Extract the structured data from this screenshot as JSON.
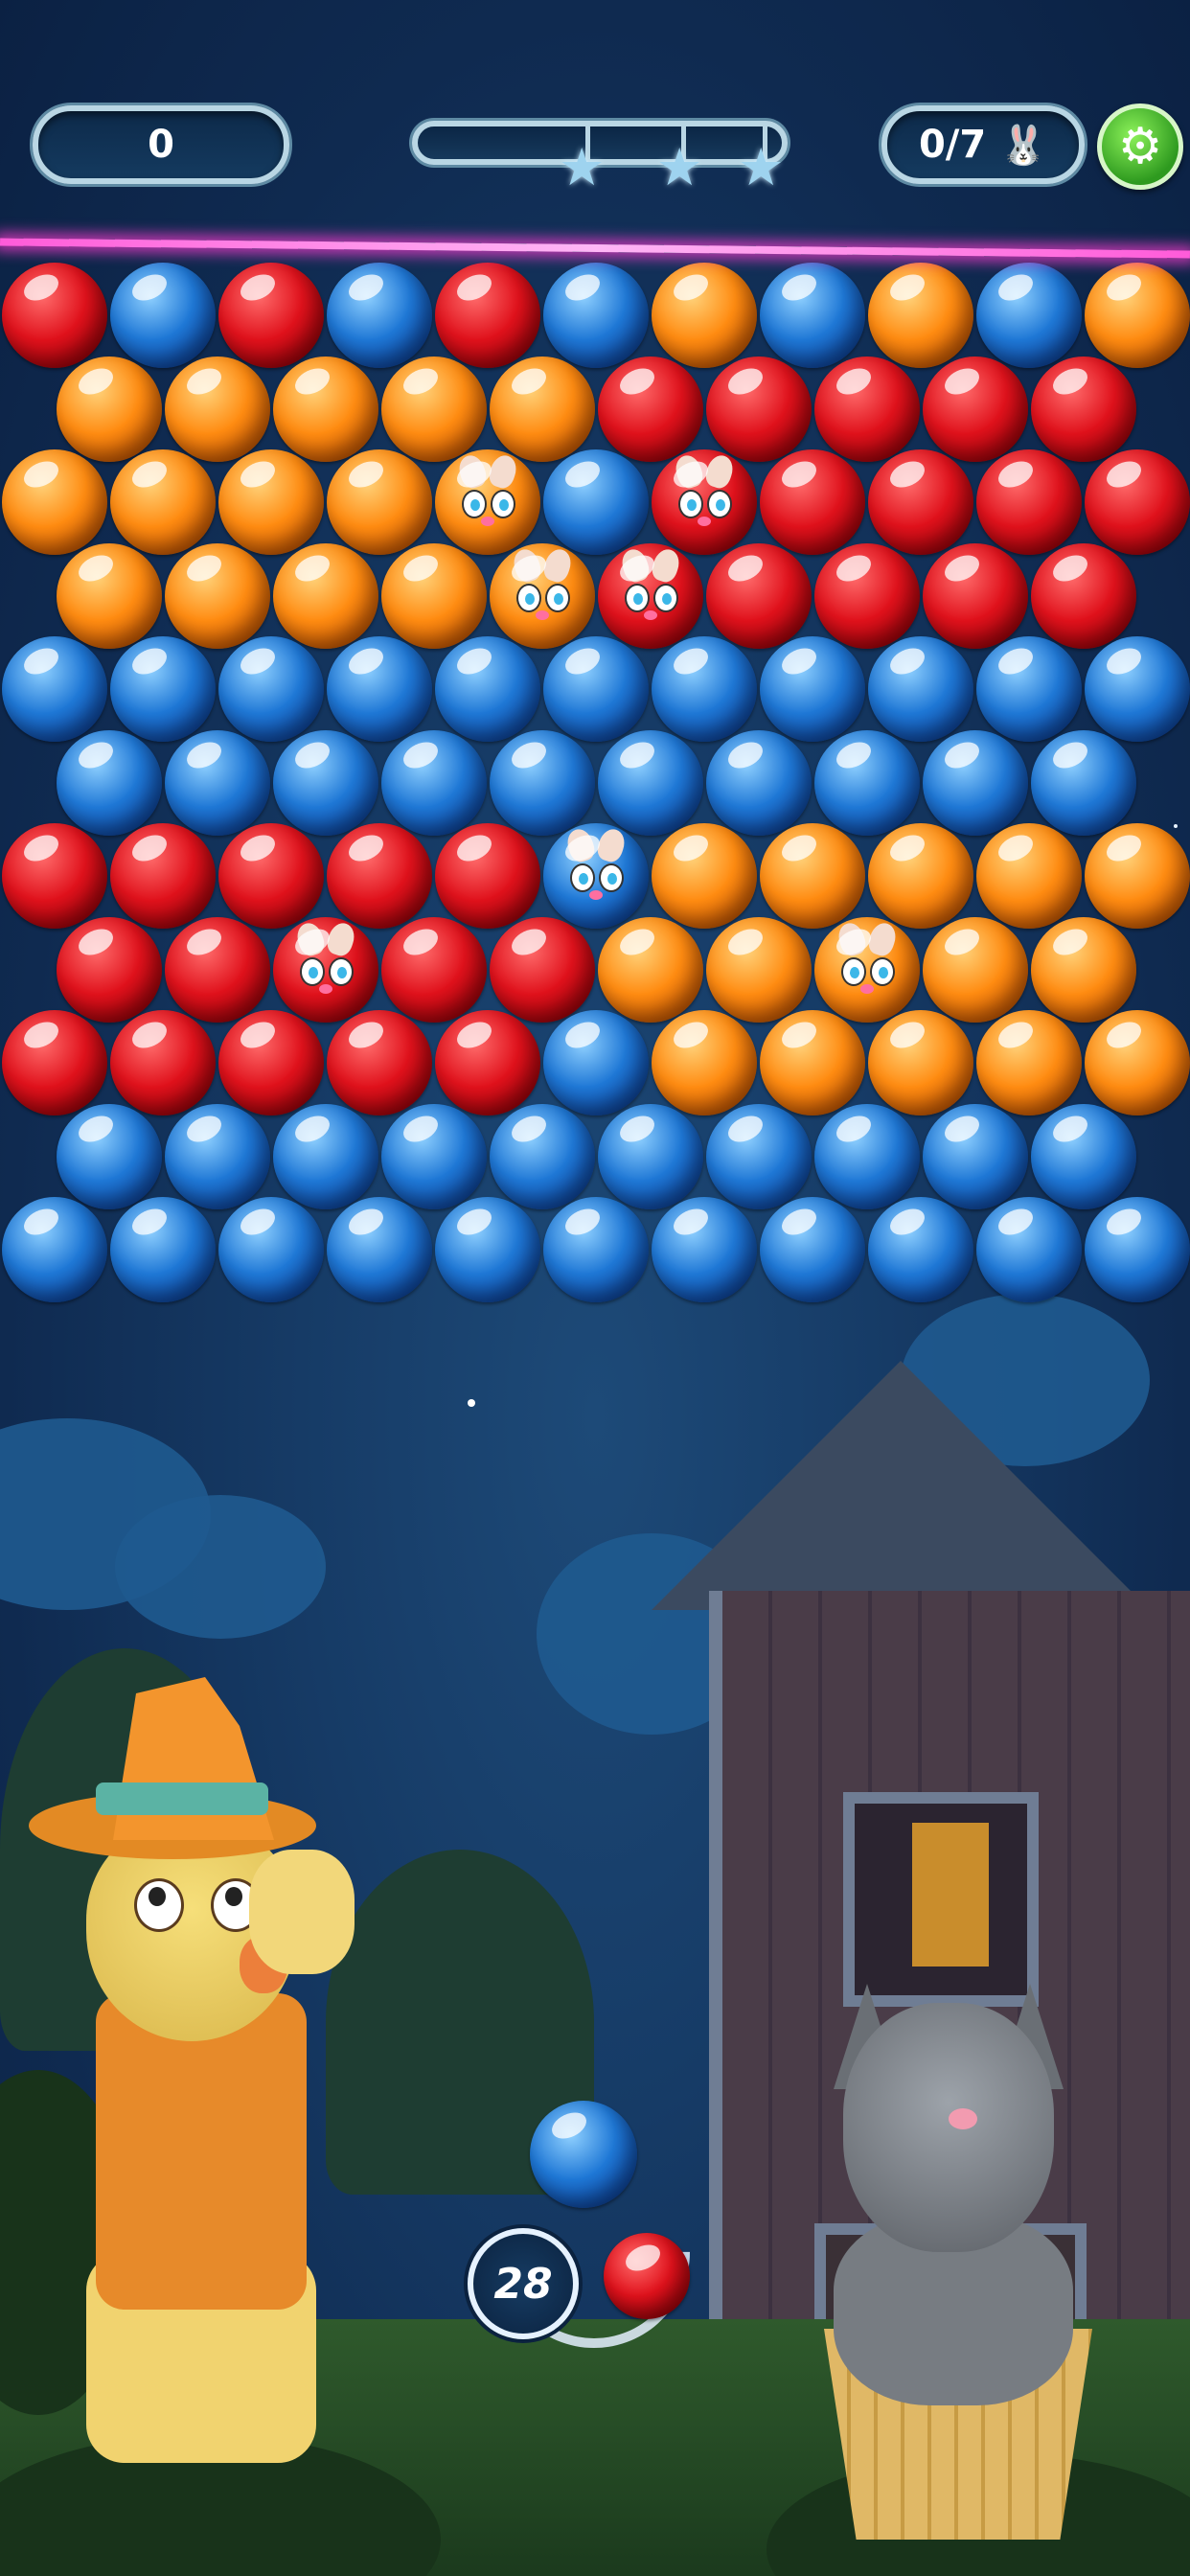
{
  "hud": {
    "score": "0",
    "goal_counter": "0/7",
    "goal_icon": "rabbit-icon",
    "settings_icon": "gear-icon",
    "progress_fraction": 0.0,
    "stars": 3,
    "colors": {
      "settings_green": "#4fc22e",
      "laser": "#ff5bd9"
    }
  },
  "board": {
    "rows": [
      {
        "offset": false,
        "cells": [
          "R",
          "B",
          "R",
          "B",
          "R",
          "B",
          "O",
          "B",
          "O",
          "B",
          "O"
        ]
      },
      {
        "offset": true,
        "cells": [
          "O",
          "O",
          "O",
          "O",
          "O",
          "R",
          "R",
          "R",
          "R",
          "R"
        ]
      },
      {
        "offset": false,
        "cells": [
          "O",
          "O",
          "O",
          "O",
          "O*",
          "B",
          "R*",
          "R",
          "R",
          "R",
          "R"
        ]
      },
      {
        "offset": true,
        "cells": [
          "O",
          "O",
          "O",
          "O",
          "O*",
          "R*",
          "R",
          "R",
          "R",
          "R"
        ]
      },
      {
        "offset": false,
        "cells": [
          "B",
          "B",
          "B",
          "B",
          "B",
          "B",
          "B",
          "B",
          "B",
          "B",
          "B"
        ]
      },
      {
        "offset": true,
        "cells": [
          "B",
          "B",
          "B",
          "B",
          "B",
          "B",
          "B",
          "B",
          "B",
          "B"
        ]
      },
      {
        "offset": false,
        "cells": [
          "R",
          "R",
          "R",
          "R",
          "R",
          "B*",
          "O",
          "O",
          "O",
          "O",
          "O"
        ]
      },
      {
        "offset": true,
        "cells": [
          "R",
          "R",
          "R*",
          "R",
          "R",
          "O",
          "O",
          "O*",
          "O",
          "O"
        ]
      },
      {
        "offset": false,
        "cells": [
          "R",
          "R",
          "R",
          "R",
          "R",
          "B",
          "O",
          "O",
          "O",
          "O",
          "O"
        ]
      },
      {
        "offset": true,
        "cells": [
          "B",
          "B",
          "B",
          "B",
          "B",
          "B",
          "B",
          "B",
          "B",
          "B"
        ]
      },
      {
        "offset": false,
        "cells": [
          "B",
          "B",
          "B",
          "B",
          "B",
          "B",
          "B",
          "B",
          "B",
          "B",
          "B"
        ]
      }
    ],
    "legend": {
      "R": "red",
      "B": "blue",
      "O": "orange",
      "*": "trapped-critter"
    }
  },
  "shooter": {
    "shots_left": "28",
    "current_bubble": "blue",
    "next_bubble": "red"
  }
}
